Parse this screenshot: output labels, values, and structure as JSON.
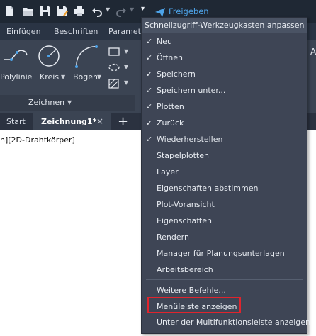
{
  "toolbar": {
    "share_label": "Freigeben",
    "icons": [
      "new-icon",
      "open-icon",
      "save-icon",
      "save-as-icon",
      "plot-icon",
      "undo-icon",
      "redo-icon",
      "customize-dropdown-icon",
      "share-icon"
    ]
  },
  "ribbon": {
    "tabs": [
      "Einfügen",
      "Beschriften",
      "Paramet"
    ],
    "tools": [
      "Polylinie",
      "Kreis",
      "Bogen"
    ],
    "panel_name": "Zeichnen"
  },
  "doc_tabs": {
    "start": "Start",
    "drawing": "Zeichnung1*"
  },
  "viewport": {
    "label": "n][2D-Drahtkörper]"
  },
  "menu": {
    "title": "Schnellzugriff-Werkzeugkasten anpassen",
    "items": [
      {
        "label": "Neu",
        "checked": true
      },
      {
        "label": "Öffnen",
        "checked": true
      },
      {
        "label": "Speichern",
        "checked": true
      },
      {
        "label": "Speichern unter...",
        "checked": true
      },
      {
        "label": "Plotten",
        "checked": true
      },
      {
        "label": "Zurück",
        "checked": true
      },
      {
        "label": "Wiederherstellen",
        "checked": true
      },
      {
        "label": "Stapelplotten",
        "checked": false
      },
      {
        "label": "Layer",
        "checked": false
      },
      {
        "label": "Eigenschaften abstimmen",
        "checked": false
      },
      {
        "label": "Plot-Voransicht",
        "checked": false
      },
      {
        "label": "Eigenschaften",
        "checked": false
      },
      {
        "label": "Rendern",
        "checked": false
      },
      {
        "label": "Manager für Planungsunterlagen",
        "checked": false
      },
      {
        "label": "Arbeitsbereich",
        "checked": false
      }
    ],
    "extra_items": [
      {
        "label": "Weitere Befehle..."
      },
      {
        "label": "Menüleiste anzeigen"
      },
      {
        "label": "Unter der Multifunktionsleiste anzeigen"
      }
    ],
    "check_glyph": "✓"
  },
  "colors": {
    "accent": "#4da3e8",
    "highlight": "#e0242d",
    "menu_bg": "#3e4555"
  }
}
